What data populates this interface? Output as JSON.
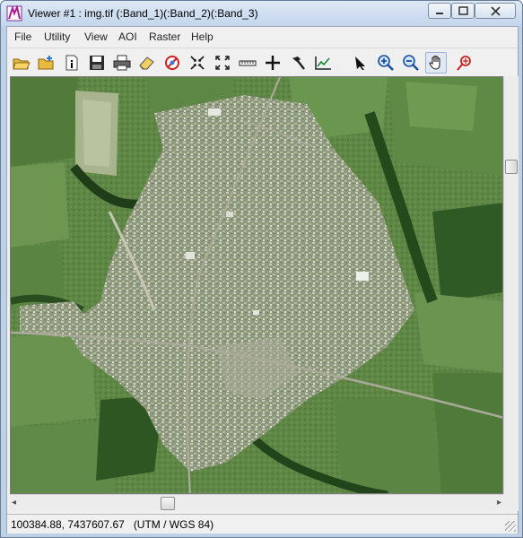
{
  "window": {
    "title": "Viewer #1 : img.tif (:Band_1)(:Band_2)(:Band_3)"
  },
  "menu": {
    "items": [
      "File",
      "Utility",
      "View",
      "AOI",
      "Raster",
      "Help"
    ]
  },
  "toolbar": {
    "buttons": [
      "open-file-icon",
      "open-layer-icon",
      "info-icon",
      "save-icon",
      "print-icon",
      "eraser-icon",
      "clear-icon",
      "fit-to-frame-icon",
      "zoom-extent-icon",
      "ruler-icon",
      "crosshair-icon",
      "hammer-icon",
      "chart-icon",
      "pointer-icon",
      "zoom-in-icon",
      "zoom-out-icon",
      "pan-hand-icon",
      "measure-icon"
    ],
    "active": "pan-hand-icon"
  },
  "status": {
    "coordinates": "100384.88, 7437607.67",
    "projection": "(UTM / WGS 84)"
  },
  "colors": {
    "title_bar": "#c4d6ec",
    "imagery_dark_green": "#3a5a2a",
    "imagery_field": "#6f8f4e",
    "urban": "#9a9a88"
  }
}
